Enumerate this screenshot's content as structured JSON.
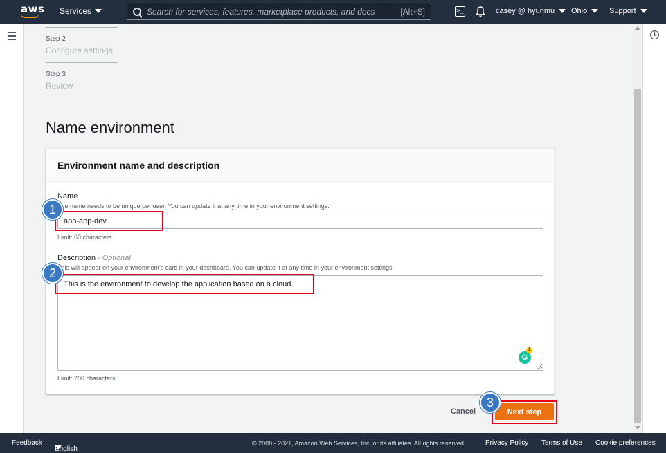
{
  "topnav": {
    "logo": "aws",
    "services_label": "Services",
    "search_placeholder": "Search for services, features, marketplace products, and docs",
    "search_shortcut": "[Alt+S]",
    "user": "casey @ hyunmu",
    "region": "Ohio",
    "support": "Support",
    "cloudshell_glyph": ">_"
  },
  "steps": [
    {
      "number": "Step 2",
      "label": "Configure settings"
    },
    {
      "number": "Step 3",
      "label": "Review"
    }
  ],
  "page_title": "Name environment",
  "panel": {
    "title": "Environment name and description",
    "name_field": {
      "label": "Name",
      "description": "The name needs to be unique per user. You can update it at any time in your environment settings.",
      "value": "app-app-dev",
      "constraint": "Limit: 60 characters"
    },
    "description_field": {
      "label": "Description",
      "optional": " - Optional",
      "description": "This will appear on your environment's card in your dashboard. You can update it at any time in your environment settings.",
      "value": "This is the environment to develop the application based on a cloud.",
      "constraint": "Limit: 200 characters"
    },
    "grammarly": {
      "letter": "G",
      "count": "1"
    }
  },
  "actions": {
    "cancel": "Cancel",
    "next": "Next step"
  },
  "annotations": [
    "1",
    "2",
    "3"
  ],
  "footer": {
    "feedback": "Feedback",
    "language": "English (US)",
    "copyright": "© 2008 - 2021, Amazon Web Services, Inc. or its affiliates. All rights reserved.",
    "privacy": "Privacy Policy",
    "terms": "Terms of Use",
    "cookies": "Cookie preferences"
  },
  "colors": {
    "nav_bg": "#232f3e",
    "primary_button": "#ec7211",
    "highlight": "#e4001e",
    "annotation_badge": "#3b78c2"
  },
  "icons": [
    "menu-icon",
    "search-icon",
    "cloudshell-icon",
    "bell-icon",
    "info-icon",
    "chevron-down-icon",
    "grammarly-icon"
  ]
}
